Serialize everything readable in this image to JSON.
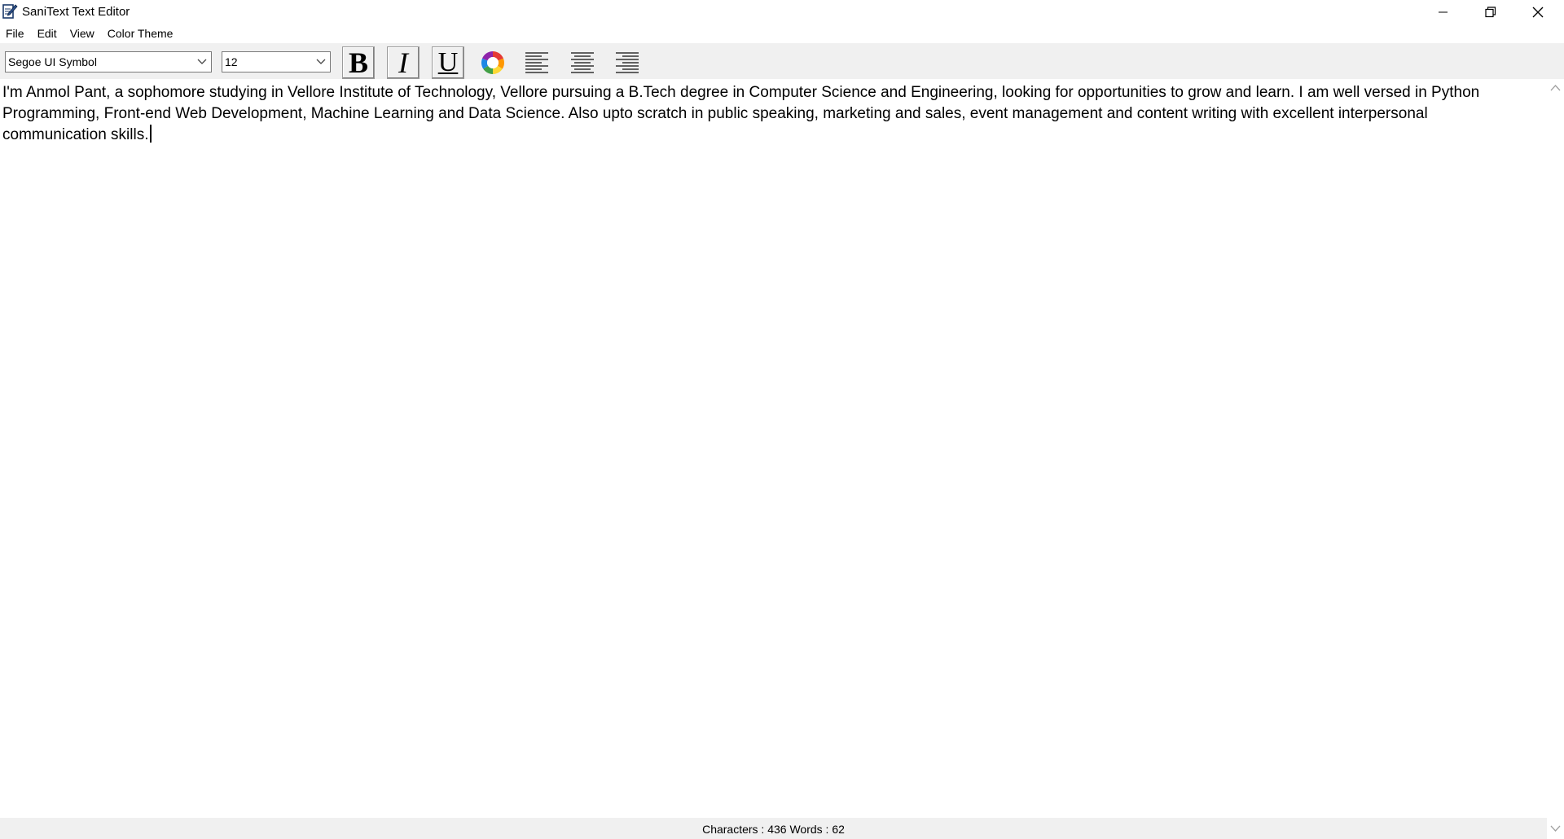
{
  "window": {
    "title": "SaniText Text Editor",
    "icons": {
      "app": "notepad-pen-icon",
      "minimize": "minimize-icon",
      "maximize": "restore-icon",
      "close": "close-icon"
    }
  },
  "menu": {
    "items": [
      {
        "label": "File"
      },
      {
        "label": "Edit"
      },
      {
        "label": "View"
      },
      {
        "label": "Color Theme"
      }
    ]
  },
  "toolbar": {
    "font_family": "Segoe UI Symbol",
    "font_size": "12",
    "bold_glyph": "B",
    "italic_glyph": "I",
    "underline_glyph": "U",
    "icons": {
      "color": "color-wheel-icon",
      "align_left": "align-left-icon",
      "align_center": "align-center-icon",
      "align_right": "align-right-icon",
      "dropdown": "chevron-down-icon"
    }
  },
  "editor": {
    "content": "I'm Anmol Pant, a sophomore studying in Vellore Institute of Technology, Vellore pursuing a B.Tech degree in Computer Science and Engineering, looking for opportunities to grow and learn. I am well versed in Python Programming, Front-end Web Development, Machine Learning and Data Science. Also upto scratch in public speaking, marketing and sales, event management and content writing with excellent interpersonal communication skills."
  },
  "status": {
    "text": "Characters : 436 Words : 62"
  },
  "colors": {
    "toolbar_bg": "#f0f0f0",
    "editor_bg": "#ffffff",
    "text": "#000000"
  }
}
